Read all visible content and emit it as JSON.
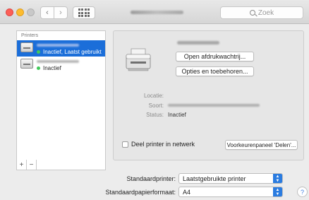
{
  "toolbar": {
    "back_icon": "‹",
    "forward_icon": "›",
    "search_placeholder": "Zoek"
  },
  "printers": {
    "header": "Printers",
    "items": [
      {
        "status": "Inactief, Laatst gebruikt",
        "selected": true
      },
      {
        "status": "Inactief",
        "selected": false
      }
    ],
    "add_label": "+",
    "remove_label": "−"
  },
  "detail": {
    "open_queue_label": "Open afdrukwachtrij...",
    "options_label": "Opties en toebehoren...",
    "location_label": "Locatie:",
    "kind_label": "Soort:",
    "status_label": "Status:",
    "status_value": "Inactief",
    "share_label": "Deel printer in netwerk",
    "sharing_prefs_label": "Voorkeurenpaneel 'Delen'..."
  },
  "defaults": {
    "printer_label": "Standaardprinter:",
    "printer_value": "Laatstgebruikte printer",
    "paper_label": "Standaardpapierformaat:",
    "paper_value": "A4"
  },
  "help_label": "?",
  "colors": {
    "selection": "#1b6ed9",
    "status_dot": "#42c95a",
    "select_accent": "#2b7ce0"
  }
}
